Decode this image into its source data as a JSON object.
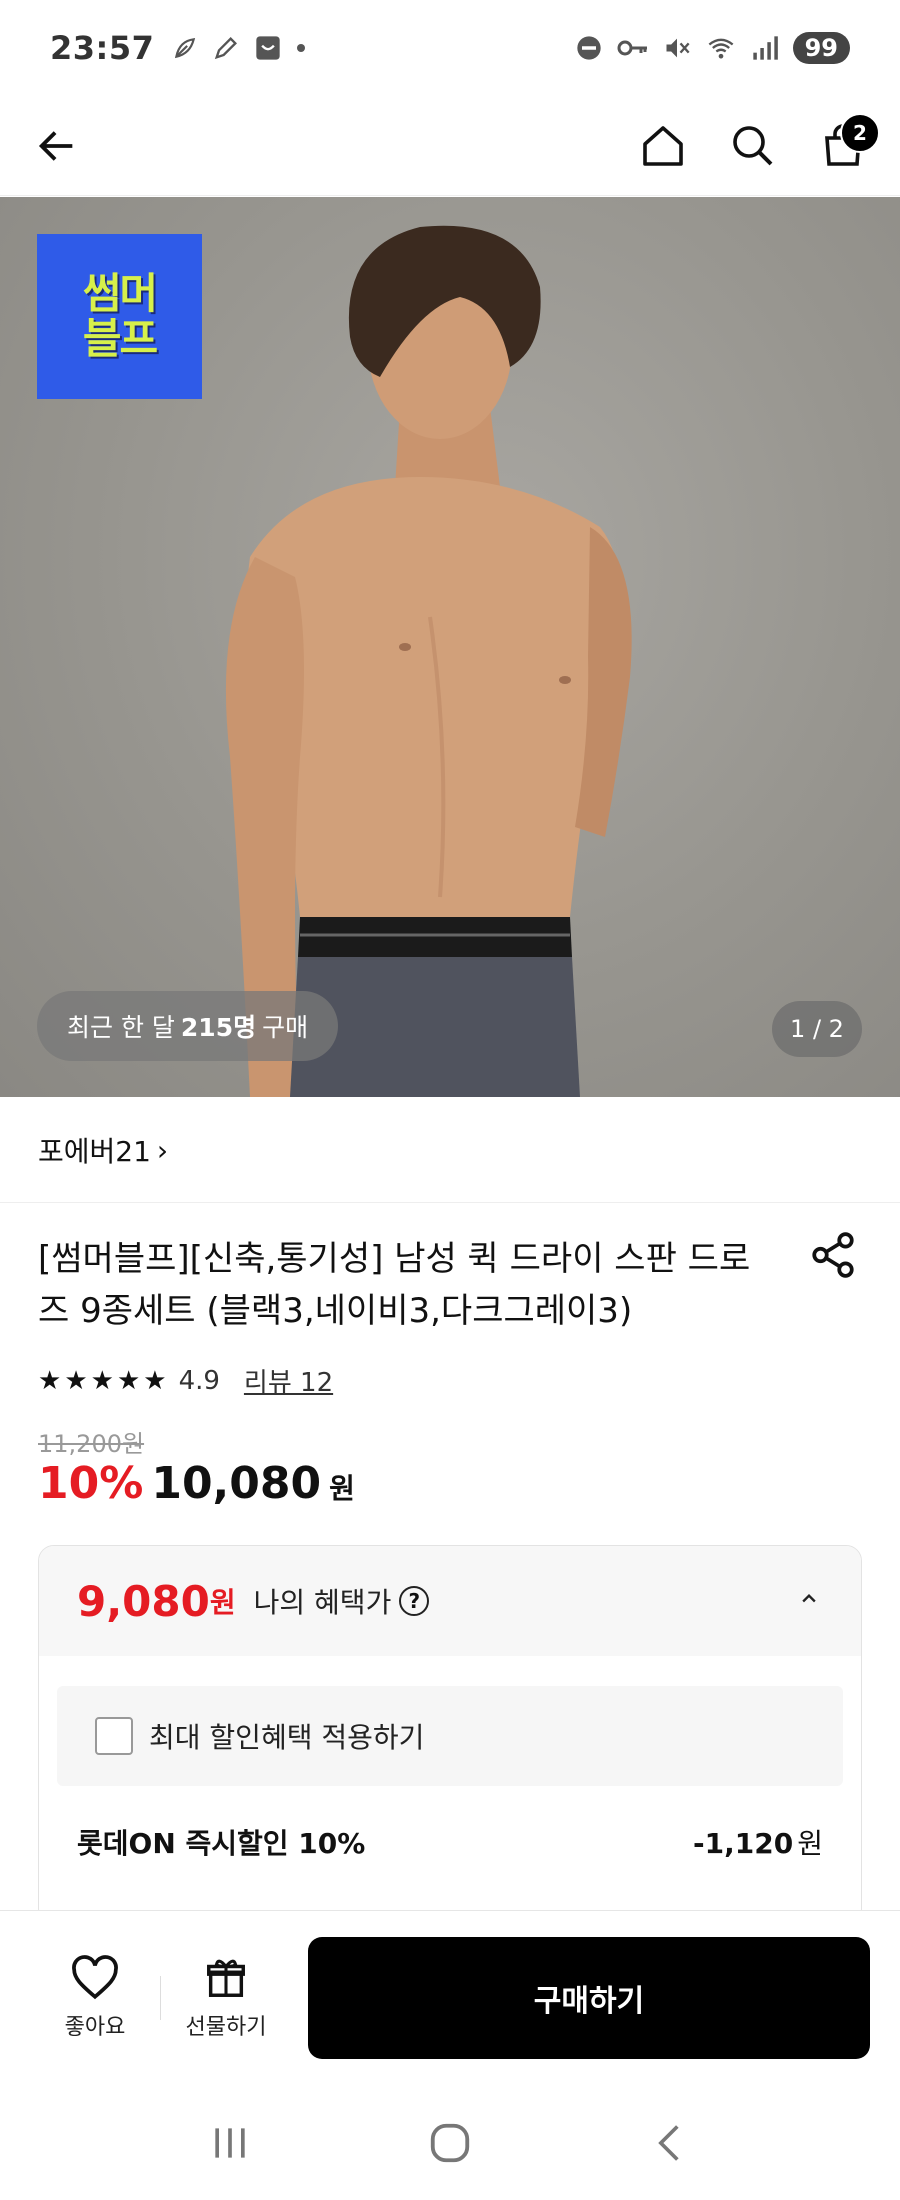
{
  "status_bar": {
    "time": "23:57",
    "battery": "99"
  },
  "nav": {
    "cart_count": "2"
  },
  "hero": {
    "promo_badge_line1": "썸머",
    "promo_badge_line2": "블프",
    "buyers_prefix": "최근 한 달",
    "buyers_count": "215명",
    "buyers_suffix": "구매",
    "page_indicator": "1 / 2"
  },
  "brand": {
    "name": "포에버21",
    "chevron": "›"
  },
  "product": {
    "title": "[썸머블프][신축,통기성] 남성 퀵 드라이 스판 드로즈 9종세트 (블랙3,네이비3,다크그레이3)",
    "rating": "4.9",
    "review_link": "리뷰 12",
    "original_price": "11,200원",
    "discount_rate": "10%",
    "sale_price": "10,080",
    "won": "원"
  },
  "benefit": {
    "price": "9,080",
    "won": "원",
    "label": "나의 혜택가",
    "help": "?",
    "max_discount_label": "최대 할인혜택 적용하기",
    "discount_name": "롯데ON 즉시할인 10%",
    "discount_amount": "-1,120",
    "discount_won": "원"
  },
  "actions": {
    "like_label": "좋아요",
    "gift_label": "선물하기",
    "buy_label": "구매하기"
  },
  "colors": {
    "accent_red": "#e51c23",
    "promo_blue": "#2f5be8",
    "promo_yellow": "#d7f04a"
  }
}
